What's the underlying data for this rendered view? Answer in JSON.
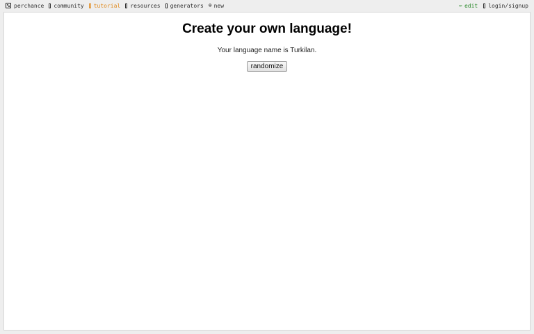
{
  "nav": {
    "left": [
      {
        "label": "perchance",
        "icon": "dice-icon"
      },
      {
        "label": "community",
        "icon": "community-icon"
      },
      {
        "label": "tutorial",
        "icon": "tutorial-icon"
      },
      {
        "label": "resources",
        "icon": "resources-icon"
      },
      {
        "label": "generators",
        "icon": "generators-icon"
      },
      {
        "label": "new",
        "icon": "plus-circle-icon"
      }
    ],
    "right": [
      {
        "label": "edit",
        "icon": "pencil-icon"
      },
      {
        "label": "login/signup",
        "icon": "user-icon"
      }
    ],
    "glyphs": {
      "new_icon": "⊕",
      "edit_icon": "✏"
    }
  },
  "colors": {
    "tutorial": "#e08a1e",
    "edit": "#2e8b2e"
  },
  "main": {
    "title": "Create your own language!",
    "sentence_prefix": "Your language name is ",
    "language_name": "Turkilan",
    "sentence_suffix": ".",
    "randomize_label": "randomize"
  }
}
